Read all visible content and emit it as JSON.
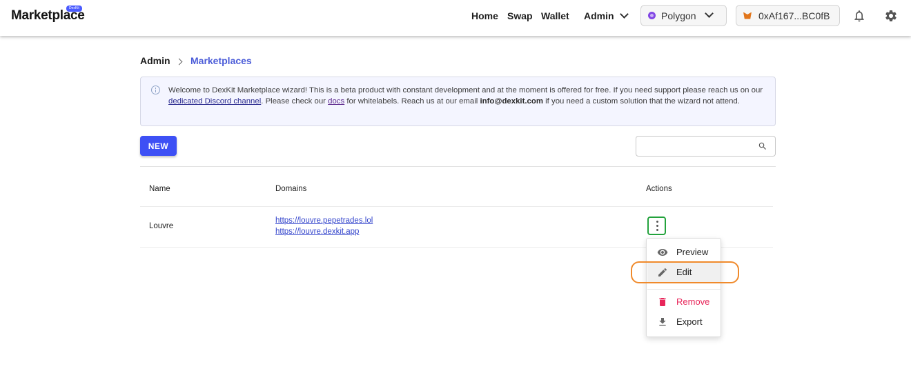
{
  "header": {
    "logo": "Marketplace",
    "logo_badge": "DexKit",
    "nav": [
      "Home",
      "Swap",
      "Wallet"
    ],
    "admin_label": "Admin",
    "network_label": "Polygon",
    "wallet_label": "0xAf167...BC0fB"
  },
  "breadcrumb": {
    "root": "Admin",
    "current": "Marketplaces"
  },
  "alert": {
    "t1": "Welcome to DexKit Marketplace wizard! This is a beta product with constant development and at the moment is offered for free. If you need support please reach us on our ",
    "discord_link": "dedicated Discord channel",
    "t2": ". Please check our ",
    "docs_link": "docs",
    "t3": " for whitelabels. Reach us at our email ",
    "email": "info@dexkit.com",
    "t4": " if you need a custom solution that the wizard not attend."
  },
  "toolbar": {
    "new_label": "NEW",
    "search_value": ""
  },
  "table": {
    "headers": [
      "Name",
      "Domains",
      "Actions"
    ],
    "rows": [
      {
        "name": "Louvre",
        "domains": [
          "https://louvre.pepetrades.lol",
          "https://louvre.dexkit.app"
        ]
      }
    ]
  },
  "menu": {
    "items": [
      "Preview",
      "Edit",
      "Remove",
      "Export"
    ]
  },
  "colors": {
    "primary": "#3d50f5",
    "danger": "#e8265a",
    "kebab_outline": "#23a23c",
    "highlight": "#f08a2b"
  },
  "icons": [
    "bell-icon",
    "gear-icon",
    "search-icon",
    "info-icon",
    "eye-icon",
    "pencil-icon",
    "trash-icon",
    "download-icon",
    "more-vert-icon"
  ]
}
